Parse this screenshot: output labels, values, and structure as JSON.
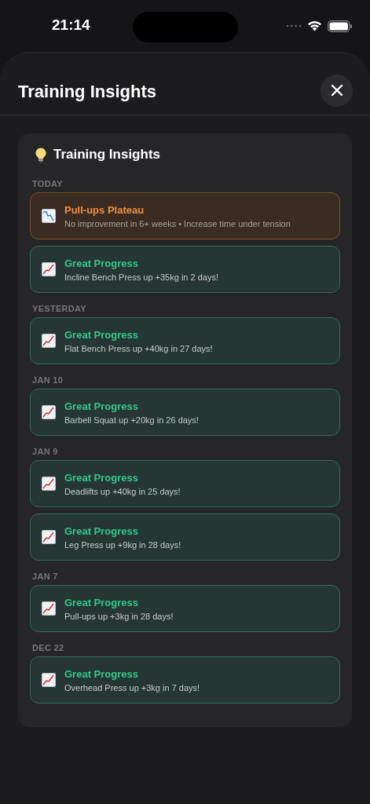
{
  "status_bar": {
    "time": "21:14"
  },
  "sheet": {
    "title": "Training Insights"
  },
  "card": {
    "title": "Training Insights",
    "groups": [
      {
        "date": "TODAY",
        "items": [
          {
            "kind": "plateau",
            "title": "Pull-ups Plateau",
            "detail": "No improvement in 6+ weeks • Increase time under tension"
          },
          {
            "kind": "progress",
            "title": "Great Progress",
            "detail": "Incline Bench Press up +35kg in 2 days!"
          }
        ]
      },
      {
        "date": "YESTERDAY",
        "items": [
          {
            "kind": "progress",
            "title": "Great Progress",
            "detail": "Flat Bench Press up +40kg in 27 days!"
          }
        ]
      },
      {
        "date": "JAN 10",
        "items": [
          {
            "kind": "progress",
            "title": "Great Progress",
            "detail": "Barbell Squat up +20kg in 26 days!"
          }
        ]
      },
      {
        "date": "JAN 9",
        "items": [
          {
            "kind": "progress",
            "title": "Great Progress",
            "detail": "Deadlifts up +40kg in 25 days!"
          },
          {
            "kind": "progress",
            "title": "Great Progress",
            "detail": "Leg Press up +9kg in 28 days!"
          }
        ]
      },
      {
        "date": "JAN 7",
        "items": [
          {
            "kind": "progress",
            "title": "Great Progress",
            "detail": "Pull-ups up +3kg in 28 days!"
          }
        ]
      },
      {
        "date": "DEC 22",
        "items": [
          {
            "kind": "progress",
            "title": "Great Progress",
            "detail": "Overhead Press up +3kg in 7 days!"
          }
        ]
      }
    ]
  }
}
